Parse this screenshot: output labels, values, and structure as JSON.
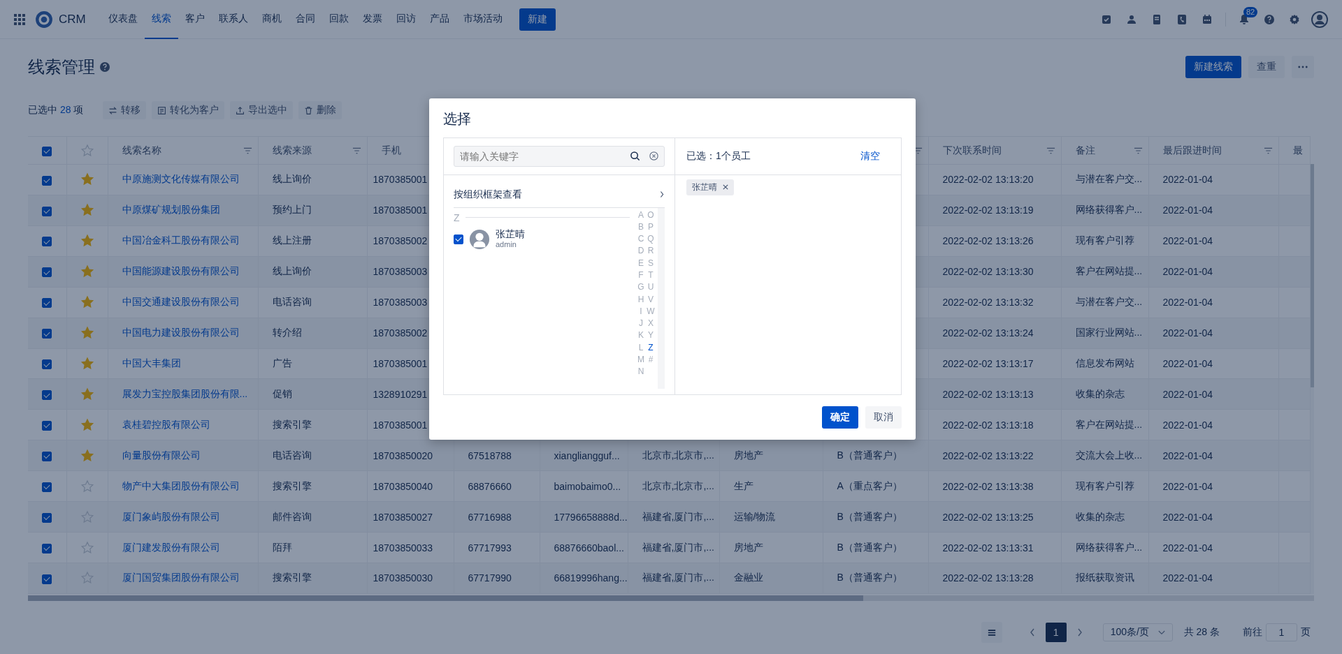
{
  "nav": {
    "app_name": "CRM",
    "items": [
      {
        "label": "仪表盘",
        "selected": false
      },
      {
        "label": "线索",
        "selected": true
      },
      {
        "label": "客户",
        "selected": false
      },
      {
        "label": "联系人",
        "selected": false
      },
      {
        "label": "商机",
        "selected": false
      },
      {
        "label": "合同",
        "selected": false
      },
      {
        "label": "回款",
        "selected": false
      },
      {
        "label": "发票",
        "selected": false
      },
      {
        "label": "回访",
        "selected": false
      },
      {
        "label": "产品",
        "selected": false
      },
      {
        "label": "市场活动",
        "selected": false
      }
    ],
    "create_button": "新建",
    "notification_count": "82"
  },
  "page": {
    "title": "线索管理",
    "buttons": [
      {
        "label": "新建线索",
        "kind": "primary"
      },
      {
        "label": "查重",
        "kind": "secondary"
      }
    ]
  },
  "selection": {
    "prefix": "已选中",
    "count": "28",
    "suffix": "项",
    "actions": [
      {
        "label": "转移",
        "kind": "transfer"
      },
      {
        "label": "转化为客户",
        "kind": "convert"
      },
      {
        "label": "导出选中",
        "kind": "export"
      },
      {
        "label": "删除",
        "kind": "delete"
      }
    ]
  },
  "table": {
    "header_checked": true,
    "columns": [
      {
        "label": "线索名称",
        "filterable": true
      },
      {
        "label": "线索来源",
        "filterable": true
      },
      {
        "label": "手机",
        "filterable": false
      },
      {
        "filterable": true
      },
      {
        "label": "下次联系时间",
        "filterable": true
      },
      {
        "label": "备注",
        "filterable": true
      },
      {
        "label": "最后跟进时间",
        "filterable": true
      },
      {
        "label": "最",
        "filterable": false
      }
    ],
    "rows": [
      {
        "checked": true,
        "starred": true,
        "name": "中原施测文化传媒有限公司",
        "source": "线上询价",
        "mobile": "1870385001",
        "next_contact": "2022-02-02 13:13:20",
        "note": "与潜在客户交...",
        "last_followup": "2022-01-04"
      },
      {
        "checked": true,
        "starred": true,
        "name": "中原煤矿规划股份集团",
        "source": "预约上门",
        "mobile": "1870385001",
        "next_contact": "2022-02-02 13:13:19",
        "note": "网络获得客户...",
        "last_followup": "2022-01-04"
      },
      {
        "checked": true,
        "starred": true,
        "name": "中国冶金科工股份有限公司",
        "source": "线上注册",
        "mobile": "1870385002",
        "next_contact": "2022-02-02 13:13:26",
        "note": "现有客户引荐",
        "last_followup": "2022-01-04"
      },
      {
        "checked": true,
        "starred": true,
        "name": "中国能源建设股份有限公司",
        "source": "线上询价",
        "mobile": "1870385003",
        "next_contact": "2022-02-02 13:13:30",
        "note": "客户在网站提...",
        "last_followup": "2022-01-04"
      },
      {
        "checked": true,
        "starred": true,
        "name": "中国交通建设股份有限公司",
        "source": "电话咨询",
        "mobile": "1870385003",
        "next_contact": "2022-02-02 13:13:32",
        "note": "与潜在客户交...",
        "last_followup": "2022-01-04"
      },
      {
        "checked": true,
        "starred": true,
        "name": "中国电力建设股份有限公司",
        "source": "转介绍",
        "mobile": "1870385002",
        "next_contact": "2022-02-02 13:13:24",
        "note": "国家行业网站...",
        "last_followup": "2022-01-04"
      },
      {
        "checked": true,
        "starred": true,
        "name": "中国大丰集团",
        "source": "广告",
        "mobile": "1870385001",
        "next_contact": "2022-02-02 13:13:17",
        "note": "信息发布网站",
        "last_followup": "2022-01-04"
      },
      {
        "checked": true,
        "starred": true,
        "name": "展发力宝控股集团股份有限...",
        "source": "促销",
        "mobile": "1328910291",
        "next_contact": "2022-02-02 13:13:13",
        "note": "收集的杂志",
        "last_followup": "2022-01-04"
      },
      {
        "checked": true,
        "starred": true,
        "name": "袁桂碧控股有限公司",
        "source": "搜索引擎",
        "mobile": "1870385001",
        "next_contact": "2022-02-02 13:13:18",
        "note": "客户在网站提...",
        "last_followup": "2022-01-04"
      },
      {
        "checked": true,
        "starred": true,
        "name": "向量股份有限公司",
        "source": "电话咨询",
        "mobile": "18703850020",
        "phone": "67518788",
        "email": "xiangliangguf...",
        "address": "北京市,北京市,...",
        "industry": "房地产",
        "level": "B（普通客户）",
        "next_contact": "2022-02-02 13:13:22",
        "note": "交流大会上收...",
        "last_followup": "2022-01-04"
      },
      {
        "checked": true,
        "starred": false,
        "name": "物产中大集团股份有限公司",
        "source": "搜索引擎",
        "mobile": "18703850040",
        "phone": "68876660",
        "email": "baimobaimo0...",
        "address": "北京市,北京市,...",
        "industry": "生产",
        "level": "A（重点客户）",
        "next_contact": "2022-02-02 13:13:38",
        "note": "现有客户引荐",
        "last_followup": "2022-01-04"
      },
      {
        "checked": true,
        "starred": false,
        "name": "厦门象屿股份有限公司",
        "source": "邮件咨询",
        "mobile": "18703850027",
        "phone": "67716988",
        "email": "17796658888d...",
        "address": "福建省,厦门市,...",
        "industry": "运输/物流",
        "level": "B（普通客户）",
        "next_contact": "2022-02-02 13:13:25",
        "note": "收集的杂志",
        "last_followup": "2022-01-04"
      },
      {
        "checked": true,
        "starred": false,
        "name": "厦门建发股份有限公司",
        "source": "陌拜",
        "mobile": "18703850033",
        "phone": "67717993",
        "email": "68876660baol...",
        "address": "福建省,厦门市,...",
        "industry": "房地产",
        "level": "B（普通客户）",
        "next_contact": "2022-02-02 13:13:31",
        "note": "网络获得客户...",
        "last_followup": "2022-01-04"
      },
      {
        "checked": true,
        "starred": false,
        "name": "厦门国贸集团股份有限公司",
        "source": "搜索引擎",
        "mobile": "18703850030",
        "phone": "67717990",
        "email": "66819996hang...",
        "address": "福建省,厦门市,...",
        "industry": "金融业",
        "level": "B（普通客户）",
        "next_contact": "2022-02-02 13:13:28",
        "note": "报纸获取资讯",
        "last_followup": "2022-01-04"
      }
    ]
  },
  "pagination": {
    "pages": [
      {
        "label": "1",
        "selected": true
      }
    ],
    "page_size": "100条/页",
    "total": "共 28 条",
    "goto_label": "前往",
    "goto_value": "1",
    "page_suffix": "页"
  },
  "dialog": {
    "title": "选择",
    "search_placeholder": "请输入关键字",
    "org_link": "按组织框架查看",
    "group": "Z",
    "employees": [
      {
        "name": "张芷晴",
        "account": "admin",
        "checked": true
      }
    ],
    "index": [
      {
        "letter": "A",
        "selected": false
      },
      {
        "letter": "B",
        "selected": false
      },
      {
        "letter": "C",
        "selected": false
      },
      {
        "letter": "D",
        "selected": false
      },
      {
        "letter": "E",
        "selected": false
      },
      {
        "letter": "F",
        "selected": false
      },
      {
        "letter": "G",
        "selected": false
      },
      {
        "letter": "H",
        "selected": false
      },
      {
        "letter": "I",
        "selected": false
      },
      {
        "letter": "J",
        "selected": false
      },
      {
        "letter": "K",
        "selected": false
      },
      {
        "letter": "L",
        "selected": false
      },
      {
        "letter": "M",
        "selected": false
      },
      {
        "letter": "N",
        "selected": false
      },
      {
        "letter": "O",
        "selected": false
      },
      {
        "letter": "P",
        "selected": false
      },
      {
        "letter": "Q",
        "selected": false
      },
      {
        "letter": "R",
        "selected": false
      },
      {
        "letter": "S",
        "selected": false
      },
      {
        "letter": "T",
        "selected": false
      },
      {
        "letter": "U",
        "selected": false
      },
      {
        "letter": "V",
        "selected": false
      },
      {
        "letter": "W",
        "selected": false
      },
      {
        "letter": "X",
        "selected": false
      },
      {
        "letter": "Y",
        "selected": false
      },
      {
        "letter": "Z",
        "selected": true
      },
      {
        "letter": "#",
        "selected": false
      }
    ],
    "selected_summary": "已选：1个员工",
    "clear": "清空",
    "tags": [
      {
        "label": "张芷晴"
      }
    ],
    "buttons": [
      {
        "label": "确定",
        "kind": "primary"
      },
      {
        "label": "取消",
        "kind": "secondary"
      }
    ]
  }
}
